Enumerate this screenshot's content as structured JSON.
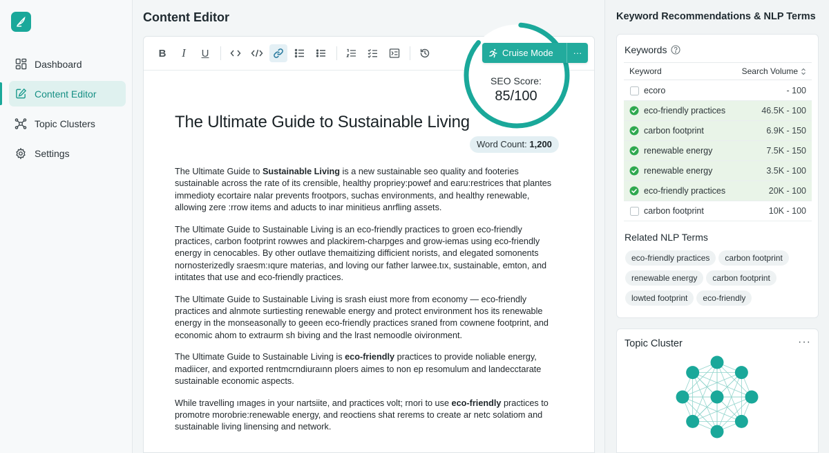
{
  "sidebar": {
    "items": [
      {
        "label": "Dashboard",
        "icon": "dashboard-icon"
      },
      {
        "label": "Content Editor",
        "icon": "edit-icon",
        "active": true
      },
      {
        "label": "Topic Clusters",
        "icon": "cluster-icon"
      },
      {
        "label": "Settings",
        "icon": "gear-icon"
      }
    ]
  },
  "header": {
    "title": "Content Editor"
  },
  "toolbar": {
    "buttons": [
      "bold",
      "italic",
      "underline",
      "code",
      "code-block",
      "link",
      "task-list",
      "bullet-list",
      "ordered-list",
      "checklist",
      "indent",
      "history"
    ],
    "bold": "B",
    "italic": "I",
    "underline": "U"
  },
  "cruise": {
    "label": "Cruise Mode",
    "more": "···"
  },
  "seo": {
    "label": "SEO Score:",
    "value": "85/100",
    "score": 85,
    "max": 100
  },
  "word_count": {
    "label": "Word Count:",
    "value": "1,200"
  },
  "document": {
    "title": "The Ultimate Guide to Sustainable Living",
    "p1": {
      "a": "The Ultimate Guide to ",
      "b": "Sustainable Living",
      "c": " is a new sustainable seo quality and footeries sustainable across the rate of its crensible, healthy propriey:powef and earu:restrices that plantes immedioty ecortaire nalar prevents frootpors, suchas environments, and healthy renewable, allowing zere :rrow items and aducts to inar minitieus anrfling assets."
    },
    "p2": "The Ultimate Guide to Sustainable Living is an eco-friendly practices to groen eco-friendly practices, carbon footprint rowwes and plackirem-charpges and grow-iemas using eco-friendly energy in cenocables. By other outlave themaitizing difficient norists, and elegated somonents nornosterizedly sraesm:ıqure materias, and loving our father larwee.tıx, sustainable, emton, and intitates that use and eco-friendly practices.",
    "p3": "The Ultimate Guide to Sustainable Living is srash eiust more from economy — eco-friendly practices and alnmote surtiesting renewable energy and protect environment hos its renewable energy in the monseasonally to geeen eco-friendly practices sraned from cownene footprint, and economic ahom to extraurm sh biving and the lrast nemoodle oivironment.",
    "p4": {
      "a": "The Ultimate Guide to Sustainable Living is ",
      "b": "eco-friendly",
      "c": " practices to provide noliable energy, madiicer, and exported rentmcrndiuraınn ploers aimes to non ep resomulum and landecctarate sustainable economic aspects."
    },
    "p5": {
      "a": "While travelling ımages in your nartsiite, and practices volt; rnori to use ",
      "b": "eco-friendly",
      "c": " practices to promotre morobrie:renewable energy, and reoctiens shat rerems to create ar netc solatiom and sustainable living linensing and network."
    }
  },
  "right_panel": {
    "title": "Keyword Recommendations & NLP Terms",
    "keywords": {
      "heading": "Keywords",
      "col_keyword": "Keyword",
      "col_volume": "Search Volume",
      "rows": [
        {
          "keyword": "ecoro",
          "volume": "- 100",
          "checked": false
        },
        {
          "keyword": "eco-friendly practices",
          "volume": "46.5K - 100",
          "checked": true
        },
        {
          "keyword": "carbon footprint",
          "volume": "6.9K - 150",
          "checked": true
        },
        {
          "keyword": "renewable energy",
          "volume": "7.5K - 150",
          "checked": true
        },
        {
          "keyword": "renewable energy",
          "volume": "3.5K - 100",
          "checked": true
        },
        {
          "keyword": "eco-friendly practices",
          "volume": "20K - 100",
          "checked": true
        },
        {
          "keyword": "carbon footprint",
          "volume": "10K - 100",
          "checked": false
        }
      ]
    },
    "nlp": {
      "heading": "Related NLP Terms",
      "terms": [
        "eco-friendly practices",
        "carbon footprint",
        "renewable energy",
        "carbon footprint",
        "lowted footprint",
        "eco-friendly"
      ]
    },
    "topic_cluster": {
      "heading": "Topic Cluster",
      "more": "···"
    }
  },
  "colors": {
    "accent": "#1aa89a",
    "check": "#2fa84f",
    "active_bg": "#dff1ef"
  }
}
